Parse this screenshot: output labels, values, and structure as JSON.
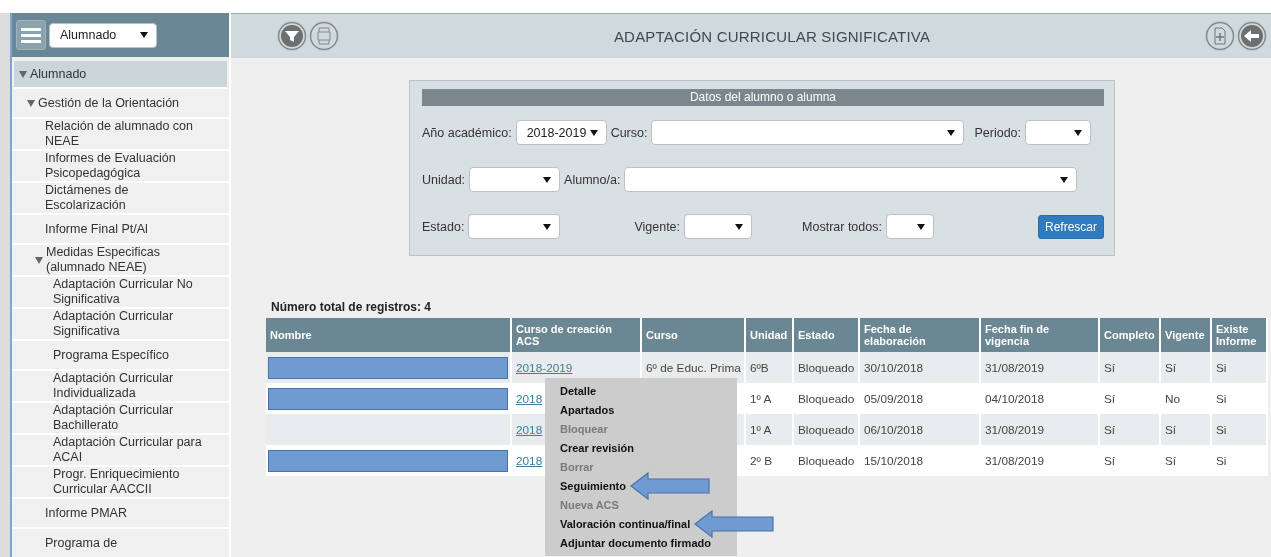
{
  "sidebar": {
    "module_select": {
      "value": "Alumnado"
    },
    "items": [
      {
        "label": "Alumnado",
        "expanded": true,
        "children": [
          {
            "label": "Gestión de la Orientación",
            "expanded": true,
            "children": [
              {
                "label": "Relación de alumnado con NEAE"
              },
              {
                "label": "Informes de Evaluación Psicopedagógica"
              },
              {
                "label": "Dictámenes de Escolarización"
              },
              {
                "label": "Informe Final Pt/Al"
              },
              {
                "label": "Medidas Especificas (alumnado NEAE)",
                "expanded": true,
                "children": [
                  {
                    "label": "Adaptación Curricular No Significativa"
                  },
                  {
                    "label": "Adaptación Curricular Significativa"
                  },
                  {
                    "label": "Programa Específico"
                  },
                  {
                    "label": "Adaptación Curricular Individualizada"
                  },
                  {
                    "label": "Adaptación Curricular Bachillerato"
                  },
                  {
                    "label": "Adaptación Curricular para ACAI"
                  },
                  {
                    "label": "Progr. Enriquecimiento Curricular AACCII"
                  }
                ]
              },
              {
                "label": "Informe PMAR"
              },
              {
                "label": "Programa de"
              }
            ]
          }
        ]
      }
    ]
  },
  "header": {
    "title": "ADAPTACIÓN CURRICULAR SIGNIFICATIVA"
  },
  "filter_panel": {
    "title": "Datos del alumno o alumna",
    "rows": [
      [
        {
          "label": "Año académico:",
          "value": "2018-2019"
        },
        {
          "label": "Curso:"
        },
        {
          "label": "Periodo:"
        }
      ],
      [
        {
          "label": "Unidad:"
        },
        {
          "label": "Alumno/a:"
        }
      ],
      [
        {
          "label": "Estado:"
        },
        {
          "label": "Vigente:"
        },
        {
          "label": "Mostrar todos:"
        }
      ]
    ],
    "button": "Refrescar"
  },
  "record_count": "Número total de registros: 4",
  "table": {
    "columns": [
      "Nombre",
      "Curso de creación ACS",
      "Curso",
      "Unidad",
      "Estado",
      "Fecha de elaboración",
      "Fecha fin de vigencia",
      "Completo",
      "Vigente",
      "Existe Informe"
    ],
    "rows": [
      {
        "name_redacted": true,
        "cells": [
          "",
          "2018-2019",
          "6º de Educ. Prima",
          "6ºB",
          "Bloqueado",
          "30/10/2018",
          "31/08/2019",
          "Sí",
          "Sí",
          "Si"
        ]
      },
      {
        "name_redacted": true,
        "cells": [
          "",
          "2018",
          null,
          "1º A",
          "Bloqueado",
          "05/09/2018",
          "04/10/2018",
          "Sí",
          "No",
          "Si"
        ]
      },
      {
        "name_redacted": false,
        "cells": [
          "",
          "2018",
          null,
          "1º A",
          "Bloqueado",
          "06/10/2018",
          "31/08/2019",
          "Sí",
          "Sí",
          "Si"
        ]
      },
      {
        "name_redacted": true,
        "cells": [
          "",
          "2018",
          null,
          "2º B",
          "Bloqueado",
          "15/10/2018",
          "31/08/2019",
          "Sí",
          "Sí",
          "Si"
        ]
      }
    ]
  },
  "context_menu": {
    "items": [
      {
        "label": "Detalle",
        "disabled": false,
        "annotated": false
      },
      {
        "label": "Apartados",
        "disabled": false,
        "annotated": false
      },
      {
        "label": "Bloquear",
        "disabled": true,
        "annotated": false
      },
      {
        "label": "Crear revisión",
        "disabled": false,
        "annotated": false
      },
      {
        "label": "Borrar",
        "disabled": true,
        "annotated": false
      },
      {
        "label": "Seguimiento",
        "disabled": false,
        "annotated": true
      },
      {
        "label": "Nueva ACS",
        "disabled": true,
        "annotated": false
      },
      {
        "label": "Valoración continua/final",
        "disabled": false,
        "annotated": true
      },
      {
        "label": "Adjuntar documento firmado",
        "disabled": false,
        "annotated": false
      }
    ]
  }
}
